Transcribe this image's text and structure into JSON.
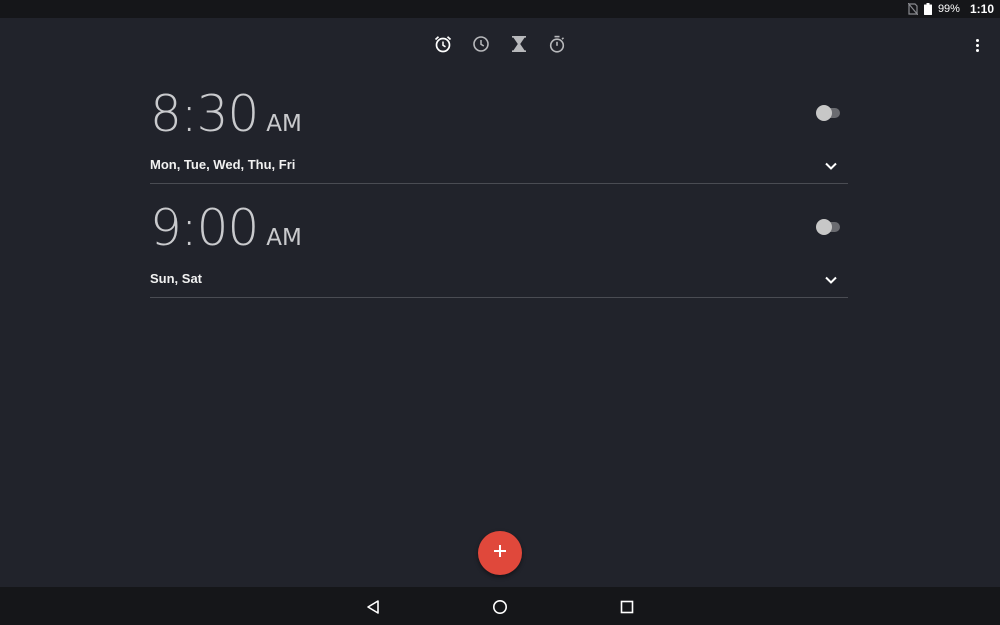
{
  "status_bar": {
    "battery": "99%",
    "time": "1:10",
    "icons": [
      "no-sim-icon",
      "battery-icon"
    ]
  },
  "tabs": [
    {
      "icon": "alarm-icon",
      "selected": true
    },
    {
      "icon": "clock-icon",
      "selected": false
    },
    {
      "icon": "timer-icon",
      "selected": false
    },
    {
      "icon": "stopwatch-icon",
      "selected": false
    }
  ],
  "alarms": [
    {
      "time": "8:30",
      "ampm": "AM",
      "days": "Mon, Tue, Wed, Thu, Fri",
      "enabled": false
    },
    {
      "time": "9:00",
      "ampm": "AM",
      "days": "Sun, Sat",
      "enabled": false
    }
  ],
  "fab": {
    "icon": "plus-icon"
  },
  "nav_bar": {
    "icons": [
      "back-icon",
      "home-icon",
      "recents-icon"
    ]
  },
  "colors": {
    "background": "#21232b",
    "bars": "#151619",
    "accent_fab": "#e0483b",
    "time_text": "#c9cacd"
  }
}
